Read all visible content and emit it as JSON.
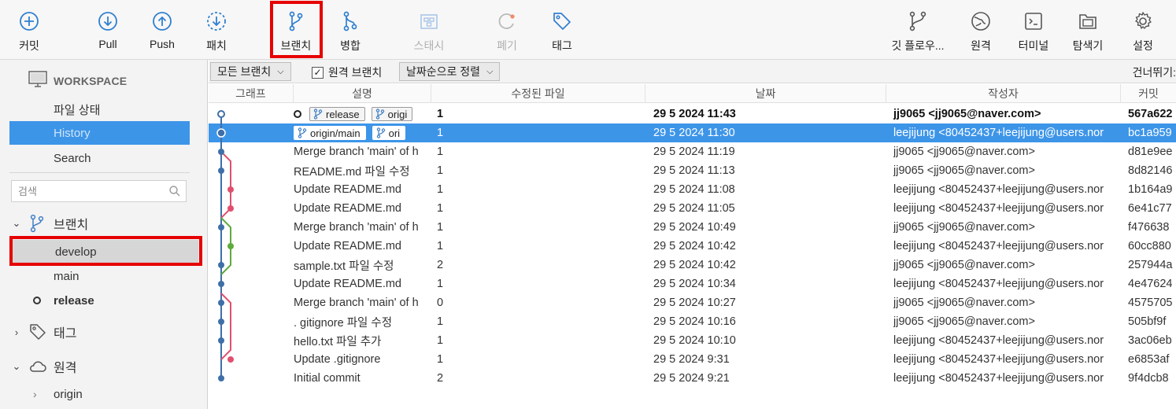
{
  "toolbar": {
    "commit": "커밋",
    "pull": "Pull",
    "push": "Push",
    "stash_patch": "패치",
    "branch": "브랜치",
    "merge": "병합",
    "stash": "스태시",
    "discard": "폐기",
    "tag": "태그",
    "git_flow": "깃 플로우...",
    "remote": "원격",
    "terminal": "터미널",
    "explorer": "탐색기",
    "settings": "설정"
  },
  "sidebar": {
    "workspace": "WORKSPACE",
    "items": [
      "파일 상태",
      "History",
      "Search"
    ],
    "search_placeholder": "검색",
    "branches_label": "브랜치",
    "branches": [
      "develop",
      "main",
      "release"
    ],
    "tags_label": "태그",
    "remotes_label": "원격",
    "remotes": [
      "origin"
    ]
  },
  "filterbar": {
    "all_branches": "모든 브랜치",
    "remote_branches": "원격 브랜치",
    "sort": "날짜순으로 정렬",
    "skip": "건너뛰기:"
  },
  "columns": {
    "graph": "그래프",
    "desc": "설명",
    "files": "수정된 파일",
    "date": "날짜",
    "author": "작성자",
    "commit": "커밋"
  },
  "commits": [
    {
      "tags": [
        "release",
        "origi"
      ],
      "desc": "",
      "files": "1",
      "date": "29 5 2024 11:43",
      "author": "jj9065 <jj9065@naver.com>",
      "hash": "567a622"
    },
    {
      "tags": [
        "origin/main",
        "ori"
      ],
      "desc": "",
      "files": "1",
      "date": "29 5 2024 11:30",
      "author": "leejijung <80452437+leejijung@users.nor",
      "hash": "bc1a959"
    },
    {
      "desc": "Merge branch 'main' of h",
      "files": "1",
      "date": "29 5 2024 11:19",
      "author": "jj9065 <jj9065@naver.com>",
      "hash": "d81e9ee"
    },
    {
      "desc": "README.md 파일 수정",
      "files": "1",
      "date": "29 5 2024 11:13",
      "author": "jj9065 <jj9065@naver.com>",
      "hash": "8d82146"
    },
    {
      "desc": "Update README.md",
      "files": "1",
      "date": "29 5 2024 11:08",
      "author": "leejijung <80452437+leejijung@users.nor",
      "hash": "1b164a9"
    },
    {
      "desc": "Update README.md",
      "files": "1",
      "date": "29 5 2024 11:05",
      "author": "leejijung <80452437+leejijung@users.nor",
      "hash": "6e41c77"
    },
    {
      "desc": "Merge branch 'main' of h",
      "files": "1",
      "date": "29 5 2024 10:49",
      "author": "jj9065 <jj9065@naver.com>",
      "hash": "f476638"
    },
    {
      "desc": "Update README.md",
      "files": "1",
      "date": "29 5 2024 10:42",
      "author": "leejijung <80452437+leejijung@users.nor",
      "hash": "60cc880"
    },
    {
      "desc": "sample.txt 파일 수정",
      "files": "2",
      "date": "29 5 2024 10:42",
      "author": "jj9065 <jj9065@naver.com>",
      "hash": "257944a"
    },
    {
      "desc": "Update README.md",
      "files": "1",
      "date": "29 5 2024 10:34",
      "author": "leejijung <80452437+leejijung@users.nor",
      "hash": "4e47624"
    },
    {
      "desc": "Merge branch 'main' of h",
      "files": "0",
      "date": "29 5 2024 10:27",
      "author": "jj9065 <jj9065@naver.com>",
      "hash": "4575705"
    },
    {
      "desc": ". gitignore 파일 수정",
      "files": "1",
      "date": "29 5 2024 10:16",
      "author": "jj9065 <jj9065@naver.com>",
      "hash": "505bf9f"
    },
    {
      "desc": "hello.txt 파일 추가",
      "files": "1",
      "date": "29 5 2024 10:10",
      "author": "leejijung <80452437+leejijung@users.nor",
      "hash": "3ac06eb"
    },
    {
      "desc": "Update .gitignore",
      "files": "1",
      "date": "29 5 2024 9:31",
      "author": "leejijung <80452437+leejijung@users.nor",
      "hash": "e6853af"
    },
    {
      "desc": "Initial commit",
      "files": "2",
      "date": "29 5 2024 9:21",
      "author": "leejijung <80452437+leejijung@users.nor",
      "hash": "9f4dcb8"
    }
  ],
  "colors": {
    "accent": "#3d95e8",
    "highlight_box": "#e60000",
    "graph_blue": "#3f6fa8",
    "graph_pink": "#e0506e",
    "graph_green": "#5cab3c"
  }
}
